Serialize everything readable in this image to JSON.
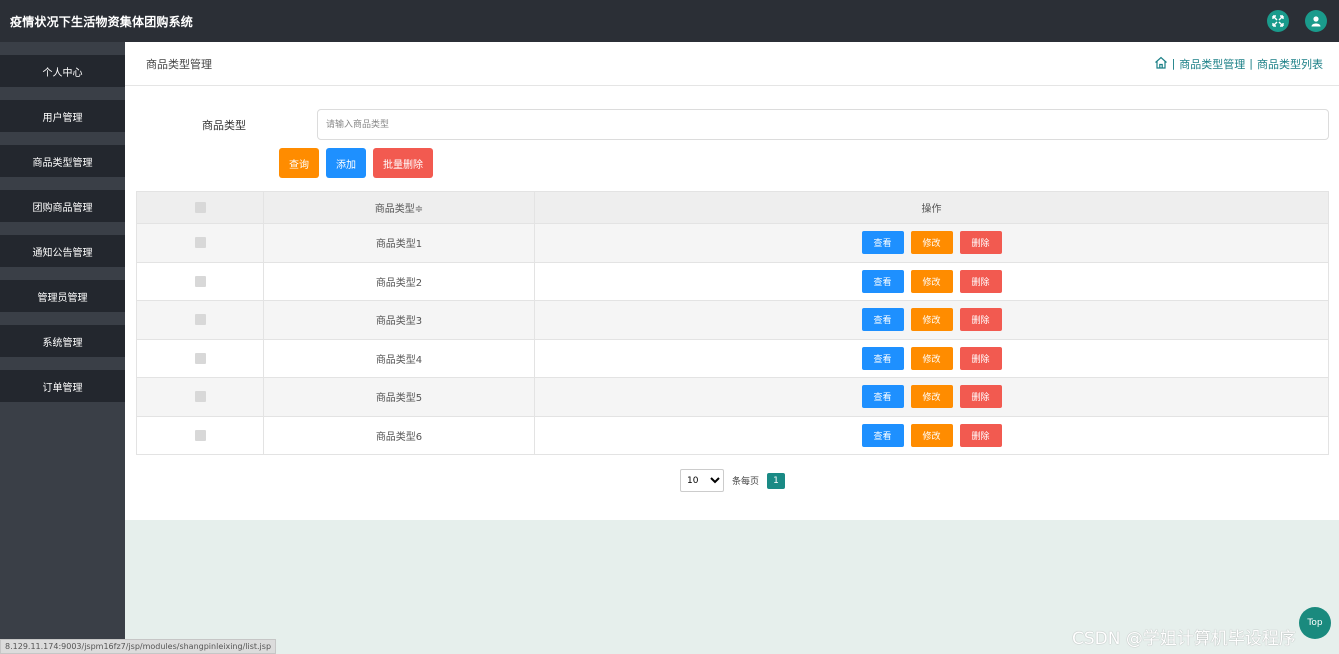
{
  "app": {
    "title": "疫情状况下生活物资集体团购系统",
    "icons": [
      "fullscreen-icon",
      "user-icon"
    ]
  },
  "sidebar": {
    "items": [
      {
        "label": "个人中心"
      },
      {
        "label": "用户管理"
      },
      {
        "label": "商品类型管理"
      },
      {
        "label": "团购商品管理"
      },
      {
        "label": "通知公告管理"
      },
      {
        "label": "管理员管理"
      },
      {
        "label": "系统管理"
      },
      {
        "label": "订单管理"
      }
    ]
  },
  "header": {
    "title": "商品类型管理",
    "breadcrumb": {
      "home_icon": "home-icon",
      "separator": "|",
      "items": [
        "商品类型管理",
        "商品类型列表"
      ]
    }
  },
  "search": {
    "label": "商品类型",
    "placeholder": "请输入商品类型",
    "value": ""
  },
  "actions": {
    "query": "查询",
    "add": "添加",
    "batch_delete": "批量删除"
  },
  "table": {
    "headers": [
      "",
      "商品类型≑",
      "操作"
    ],
    "rows": [
      {
        "name": "商品类型1"
      },
      {
        "name": "商品类型2"
      },
      {
        "name": "商品类型3"
      },
      {
        "name": "商品类型4"
      },
      {
        "name": "商品类型5"
      },
      {
        "name": "商品类型6"
      }
    ],
    "row_actions": {
      "view": "查看",
      "edit": "修改",
      "delete": "删除"
    }
  },
  "pagination": {
    "page_size": "10",
    "page_size_options": [
      "10"
    ],
    "per_page_label": "条每页",
    "current_page": "1"
  },
  "status_bar": {
    "url": "8.129.11.174:9003/jspm16fz7/jsp/modules/shangpinleixing/list.jsp"
  },
  "watermark": "CSDN @学姐计算机毕设程序",
  "top_button": "Top",
  "colors": {
    "topbar": "#2b2f36",
    "sidebar": "#3a3f47",
    "nav_item": "#23272e",
    "accent_teal": "#1a8a85",
    "orange": "#ff8c00",
    "blue": "#1e90ff",
    "red": "#f25a50"
  }
}
